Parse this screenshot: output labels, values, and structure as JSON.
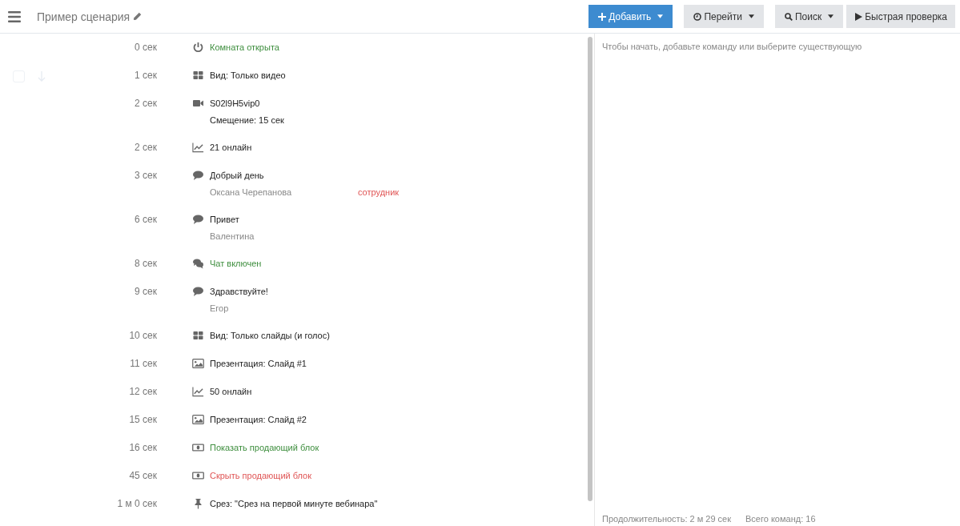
{
  "header": {
    "title": "Пример сценария",
    "buttons": [
      {
        "label": "Добавить",
        "kind": "add",
        "primary": true,
        "dropdown": true
      },
      {
        "label": "Перейти",
        "kind": "goto",
        "primary": false,
        "dropdown": true
      },
      {
        "label": "Поиск",
        "kind": "search",
        "primary": false,
        "dropdown": true
      },
      {
        "label": "Быстрая проверка",
        "kind": "play",
        "primary": false,
        "dropdown": false
      }
    ]
  },
  "commands": [
    {
      "time": "0 сек",
      "kind": "room",
      "text": "Комната открыта",
      "color": "#3e8e3e",
      "hovered": false
    },
    {
      "time": "1 сек",
      "kind": "layout",
      "text": "Вид: Только видео",
      "hovered": true
    },
    {
      "time": "2 сек",
      "kind": "video",
      "text": "S02l9H5vip0",
      "hovered": false,
      "offset": "Смещение: 15 сек"
    },
    {
      "time": "2 сек",
      "kind": "online",
      "text": "21 онлайн",
      "hovered": false
    },
    {
      "time": "3 сек",
      "kind": "message",
      "text": "Добрый день",
      "hovered": false,
      "author": "Оксана Черепанова",
      "role": "сотрудник"
    },
    {
      "time": "6 сек",
      "kind": "message",
      "text": "Привет",
      "hovered": false,
      "author": "Валентина"
    },
    {
      "time": "8 сек",
      "kind": "chat",
      "text": "Чат включен",
      "color": "#3e8e3e",
      "hovered": false
    },
    {
      "time": "9 сек",
      "kind": "message",
      "text": "Здравствуйте!",
      "hovered": false,
      "author": "Егор"
    },
    {
      "time": "10 сек",
      "kind": "layout",
      "text": "Вид: Только слайды (и голос)",
      "hovered": false
    },
    {
      "time": "11 сек",
      "kind": "slide",
      "text": "Презентация: Слайд #1",
      "hovered": false
    },
    {
      "time": "12 сек",
      "kind": "online",
      "text": "50 онлайн",
      "hovered": false
    },
    {
      "time": "15 сек",
      "kind": "slide",
      "text": "Презентация: Слайд #2",
      "hovered": false
    },
    {
      "time": "16 сек",
      "kind": "banner",
      "text": "Показать продающий блок",
      "color": "#3e8e3e",
      "hovered": false
    },
    {
      "time": "45 сек",
      "kind": "banner",
      "text": "Скрыть продающий блок",
      "color": "#e05555",
      "hovered": false
    },
    {
      "time": "1 м 0 сек",
      "kind": "cut",
      "text": "Срез: \"Срез на первой минуте вебинара\"",
      "hovered": false
    }
  ],
  "editor": {
    "hint": "Чтобы начать, добавьте команду или выберите существующую"
  },
  "footer": {
    "duration": "Продолжительность: 2 м 29 сек",
    "total": "Всего команд: 16"
  }
}
